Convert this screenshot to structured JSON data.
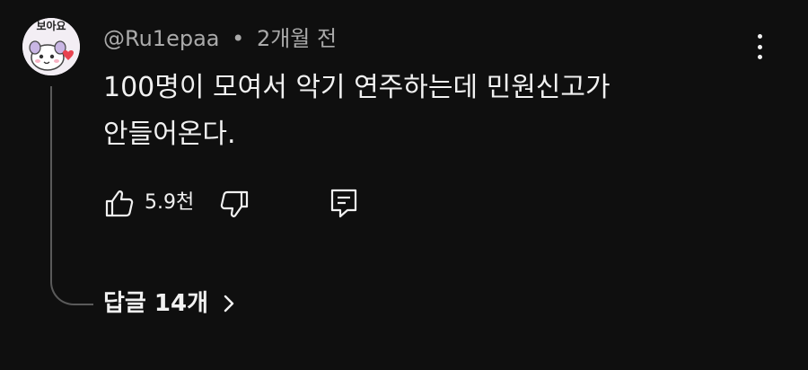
{
  "comment": {
    "author": "@Ru1epaa",
    "separator": "•",
    "time": "2개월 전",
    "avatar_text": "보아요",
    "text_line1": "100명이 모여서 악기 연주하는데 민원신고가",
    "text_line2": "안들어온다.",
    "likes": "5.9천",
    "replies_label": "답글 14개"
  },
  "icons": {
    "like": "thumbs-up-icon",
    "dislike": "thumbs-down-icon",
    "reply": "reply-icon",
    "more": "more-vertical-icon",
    "replies_chevron": "chevron-right-icon"
  },
  "colors": {
    "background": "#0f0f0f",
    "primary_text": "#f1f1f1",
    "secondary_text": "#aaaaaa",
    "thread_line": "#5a5a5a"
  }
}
